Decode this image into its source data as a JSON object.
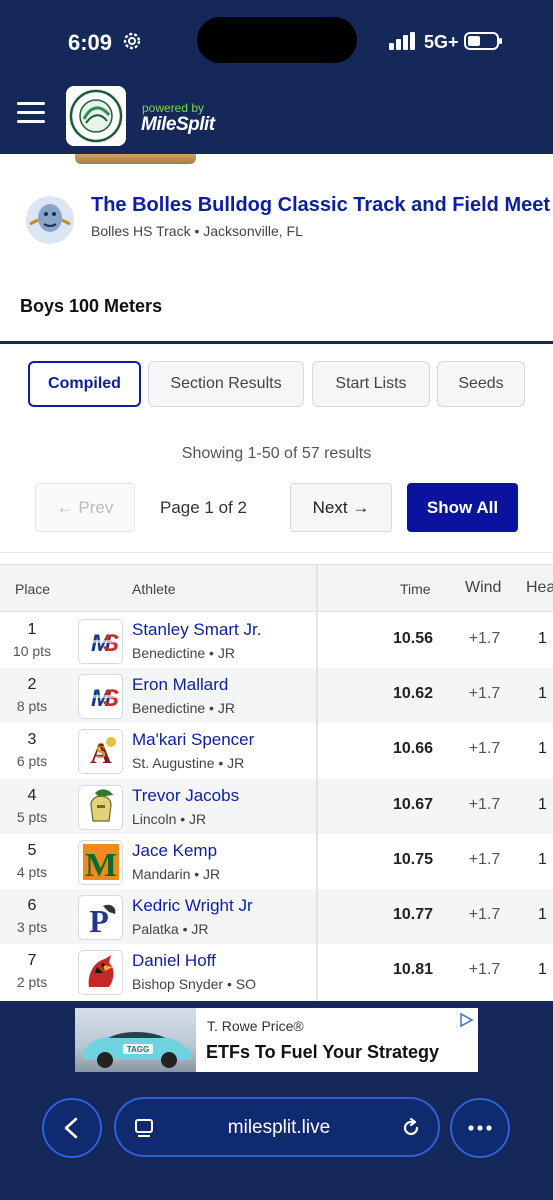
{
  "status_bar": {
    "time": "6:09",
    "network": "5G+"
  },
  "header": {
    "powered_by": "powered by",
    "brand": "MileSplit"
  },
  "meet": {
    "title": "The Bolles Bulldog Classic Track and Field Meet",
    "location": "Bolles HS Track • Jacksonville, FL"
  },
  "event": {
    "title": "Boys 100 Meters"
  },
  "tabs": [
    {
      "label": "Compiled",
      "active": true
    },
    {
      "label": "Section Results",
      "active": false
    },
    {
      "label": "Start Lists",
      "active": false
    },
    {
      "label": "Seeds",
      "active": false
    }
  ],
  "results_info": "Showing 1-50 of 57 results",
  "pager": {
    "prev": "← Prev",
    "page": "Page 1 of 2",
    "next": "Next →",
    "show_all": "Show All"
  },
  "table": {
    "headers": {
      "place": "Place",
      "athlete": "Athlete",
      "time": "Time",
      "wind": "Wind",
      "heat": "Hea"
    },
    "rows": [
      {
        "place": "1",
        "pts": "10 pts",
        "name": "Stanley Smart Jr.",
        "team": "Benedictine • JR",
        "time": "10.56",
        "wind": "+1.7",
        "heat": "1",
        "logo": "ms-logo"
      },
      {
        "place": "2",
        "pts": "8 pts",
        "name": "Eron Mallard",
        "team": "Benedictine • JR",
        "time": "10.62",
        "wind": "+1.7",
        "heat": "1",
        "logo": "ms-logo"
      },
      {
        "place": "3",
        "pts": "6 pts",
        "name": "Ma'kari Spencer",
        "team": "St. Augustine • JR",
        "time": "10.66",
        "wind": "+1.7",
        "heat": "1",
        "logo": "sa-logo"
      },
      {
        "place": "4",
        "pts": "5 pts",
        "name": "Trevor Jacobs",
        "team": "Lincoln • JR",
        "time": "10.67",
        "wind": "+1.7",
        "heat": "1",
        "logo": "trojan-logo"
      },
      {
        "place": "5",
        "pts": "4 pts",
        "name": "Jace Kemp",
        "team": "Mandarin • JR",
        "time": "10.75",
        "wind": "+1.7",
        "heat": "1",
        "logo": "m-logo"
      },
      {
        "place": "6",
        "pts": "3 pts",
        "name": "Kedric Wright Jr",
        "team": "Palatka • JR",
        "time": "10.77",
        "wind": "+1.7",
        "heat": "1",
        "logo": "p-logo"
      },
      {
        "place": "7",
        "pts": "2 pts",
        "name": "Daniel Hoff",
        "team": "Bishop Snyder • SO",
        "time": "10.81",
        "wind": "+1.7",
        "heat": "1",
        "logo": "cardinal-logo"
      }
    ]
  },
  "ad": {
    "brand": "T. Rowe Price®",
    "headline": "ETFs To Fuel Your Strategy",
    "car_text": "TAGG"
  },
  "browser": {
    "url": "milesplit.live"
  },
  "colors": {
    "navy": "#14285a",
    "link_blue": "#0d1fa0",
    "button_blue": "#0b139e",
    "accent_green": "#7bd651"
  }
}
